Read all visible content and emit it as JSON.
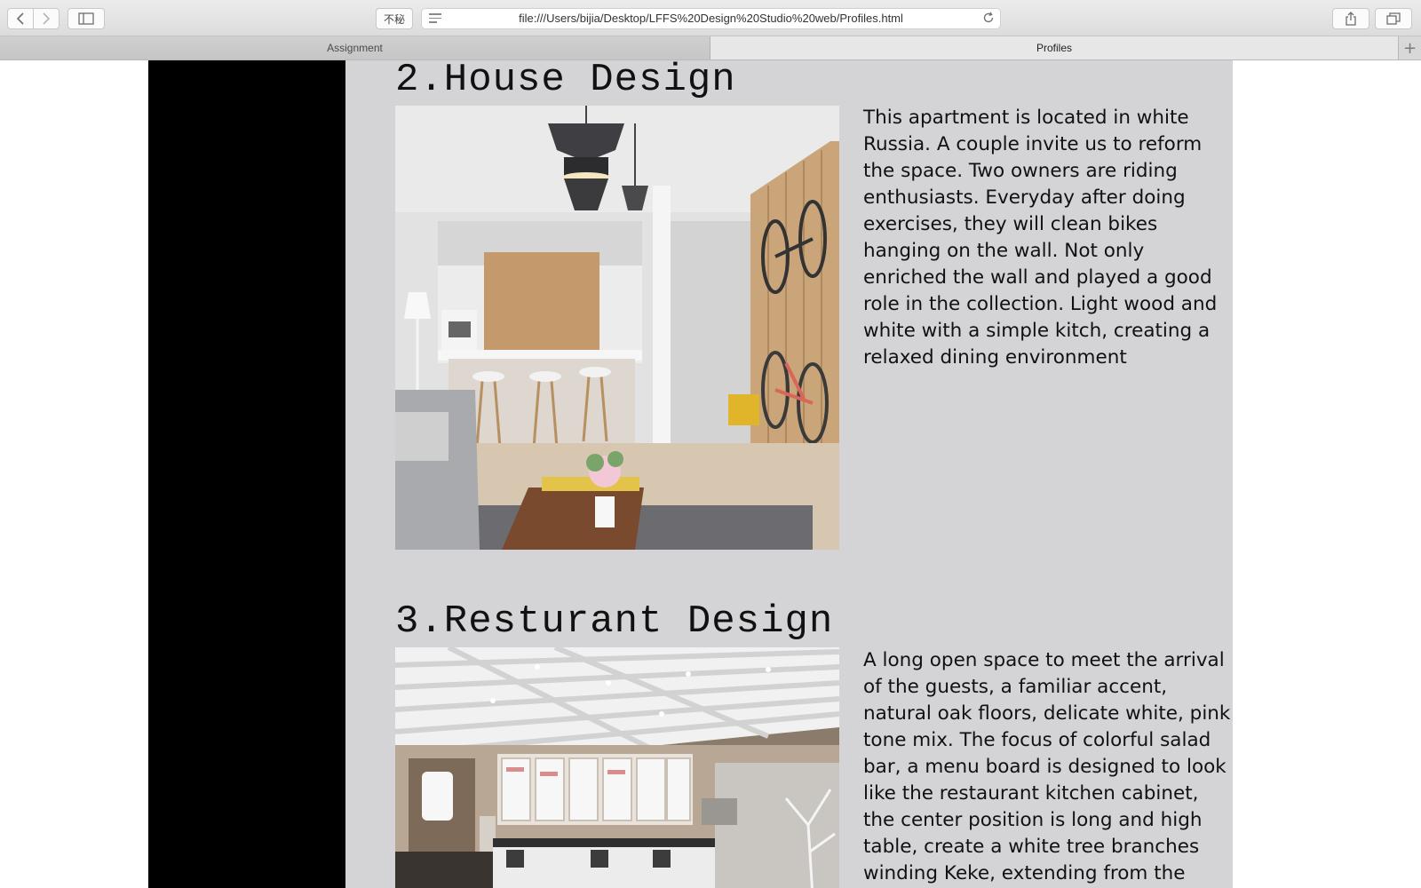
{
  "browser": {
    "url": "file:///Users/bijia/Desktop/LFFS%20Design%20Studio%20web/Profiles.html",
    "reader_label": "不秘",
    "tabs": [
      {
        "label": "Assignment"
      },
      {
        "label": "Profiles"
      }
    ]
  },
  "sections": [
    {
      "title": "2.House Design",
      "description": "This apartment is located in white Russia. A couple invite us to reform the space. Two owners are riding enthusiasts. Everyday after doing exercises, they will clean bikes hanging on the wall. Not only enriched the wall and played a good role in the collection. Light wood and white with a simple kitch, creating a relaxed dining environment"
    },
    {
      "title": "3.Resturant Design",
      "description": "A long open space to meet the arrival of the guests, a familiar accent, natural oak floors, delicate white, pink tone mix. The focus of colorful salad bar, a menu board is designed to look like the restaurant kitchen cabinet, the center position is long and high table, create a white tree branches winding Keke, extending from the ground up to the"
    }
  ]
}
